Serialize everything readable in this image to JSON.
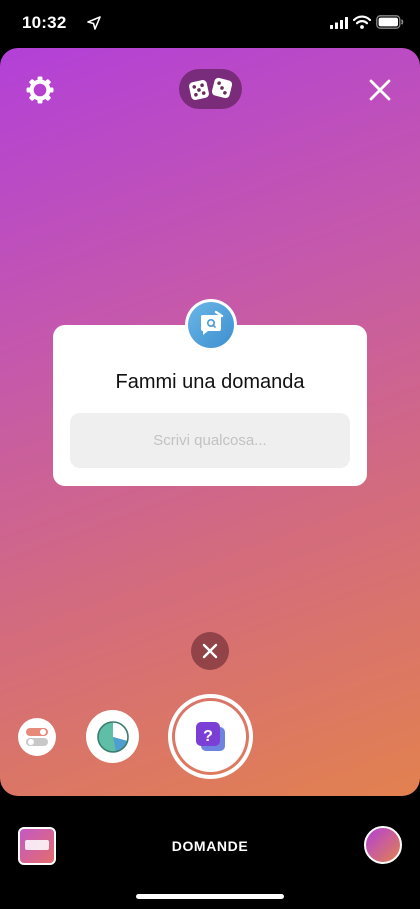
{
  "status_bar": {
    "time": "10:32",
    "icons": [
      "location-arrow-icon",
      "cellular-signal-icon",
      "wifi-icon",
      "battery-icon"
    ]
  },
  "toolbar": {
    "icons": [
      "settings-icon",
      "dice-icon",
      "close-icon"
    ]
  },
  "sticker": {
    "title": "Fammi una domanda",
    "input_placeholder": "Scrivi qualcosa...",
    "avatar_icon": "question-bubble-icon"
  },
  "tray": {
    "items": [
      "toggle-sticker-icon",
      "quiz-sticker-icon",
      "questions-sticker-icon"
    ],
    "shutter_glyph": "?"
  },
  "bottom_bar": {
    "mode_label": "DOMANDE"
  },
  "colors": {
    "gradient_start": "#b340d8",
    "gradient_end": "#e2814f",
    "accent_purple": "#7b3fd6"
  }
}
